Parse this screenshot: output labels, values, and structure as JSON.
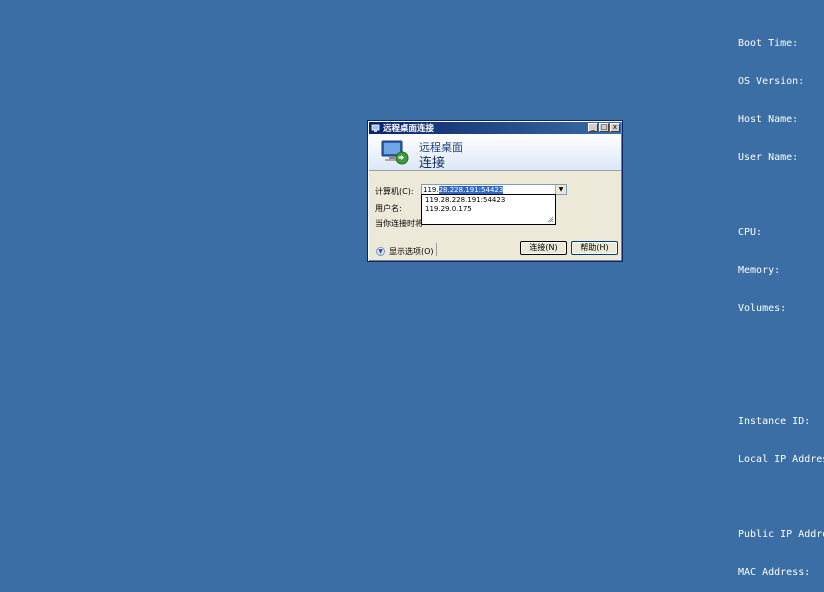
{
  "bginfo": {
    "boot_time": "Boot Time:",
    "os_version": "OS Version:",
    "host_name": "Host Name:",
    "user_name": "User Name:",
    "cpu": "CPU:",
    "memory": "Memory:",
    "volumes": "Volumes:",
    "instance_id": "Instance ID:",
    "local_ip": "Local IP Address",
    "public_ip": "Public IP Address",
    "mac_address": "MAC Address:"
  },
  "dialog": {
    "title": "远程桌面连接",
    "banner_line1": "远程桌面",
    "banner_line2": "连接",
    "computer_label": "计算机(C):",
    "computer_value_prefix": "119.",
    "computer_value_selected": "28.228.191:54423",
    "computer_options": [
      "119.28.228.191:54423",
      "119.29.0.175"
    ],
    "username_label": "用户名:",
    "hint_label": "当你连接时将",
    "options_label": "显示选项(O)",
    "connect_label": "连接(N)",
    "help_label": "帮助(H)",
    "minimize_glyph": "_",
    "maximize_glyph": "□",
    "close_glyph": "x",
    "dropdown_glyph": "▼",
    "options_glyph": "▼"
  },
  "icons": {
    "title": "remote-desktop-icon",
    "banner": "remote-desktop-monitor-icon"
  }
}
